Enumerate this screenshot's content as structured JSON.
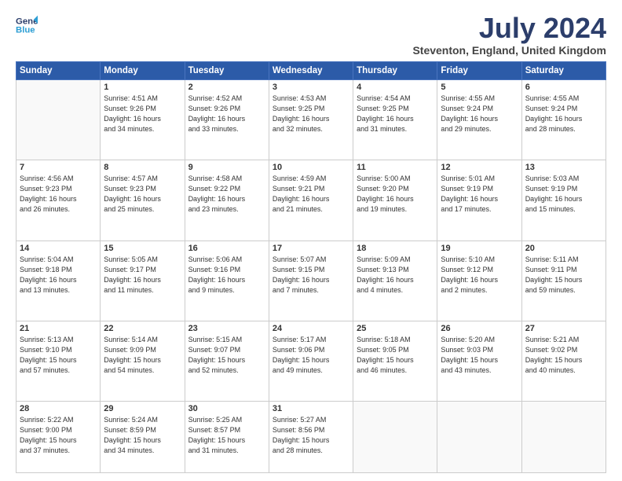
{
  "header": {
    "logo_line1": "General",
    "logo_line2": "Blue",
    "month_year": "July 2024",
    "location": "Steventon, England, United Kingdom"
  },
  "weekdays": [
    "Sunday",
    "Monday",
    "Tuesday",
    "Wednesday",
    "Thursday",
    "Friday",
    "Saturday"
  ],
  "weeks": [
    [
      {
        "day": "",
        "info": ""
      },
      {
        "day": "1",
        "info": "Sunrise: 4:51 AM\nSunset: 9:26 PM\nDaylight: 16 hours\nand 34 minutes."
      },
      {
        "day": "2",
        "info": "Sunrise: 4:52 AM\nSunset: 9:26 PM\nDaylight: 16 hours\nand 33 minutes."
      },
      {
        "day": "3",
        "info": "Sunrise: 4:53 AM\nSunset: 9:25 PM\nDaylight: 16 hours\nand 32 minutes."
      },
      {
        "day": "4",
        "info": "Sunrise: 4:54 AM\nSunset: 9:25 PM\nDaylight: 16 hours\nand 31 minutes."
      },
      {
        "day": "5",
        "info": "Sunrise: 4:55 AM\nSunset: 9:24 PM\nDaylight: 16 hours\nand 29 minutes."
      },
      {
        "day": "6",
        "info": "Sunrise: 4:55 AM\nSunset: 9:24 PM\nDaylight: 16 hours\nand 28 minutes."
      }
    ],
    [
      {
        "day": "7",
        "info": "Sunrise: 4:56 AM\nSunset: 9:23 PM\nDaylight: 16 hours\nand 26 minutes."
      },
      {
        "day": "8",
        "info": "Sunrise: 4:57 AM\nSunset: 9:23 PM\nDaylight: 16 hours\nand 25 minutes."
      },
      {
        "day": "9",
        "info": "Sunrise: 4:58 AM\nSunset: 9:22 PM\nDaylight: 16 hours\nand 23 minutes."
      },
      {
        "day": "10",
        "info": "Sunrise: 4:59 AM\nSunset: 9:21 PM\nDaylight: 16 hours\nand 21 minutes."
      },
      {
        "day": "11",
        "info": "Sunrise: 5:00 AM\nSunset: 9:20 PM\nDaylight: 16 hours\nand 19 minutes."
      },
      {
        "day": "12",
        "info": "Sunrise: 5:01 AM\nSunset: 9:19 PM\nDaylight: 16 hours\nand 17 minutes."
      },
      {
        "day": "13",
        "info": "Sunrise: 5:03 AM\nSunset: 9:19 PM\nDaylight: 16 hours\nand 15 minutes."
      }
    ],
    [
      {
        "day": "14",
        "info": "Sunrise: 5:04 AM\nSunset: 9:18 PM\nDaylight: 16 hours\nand 13 minutes."
      },
      {
        "day": "15",
        "info": "Sunrise: 5:05 AM\nSunset: 9:17 PM\nDaylight: 16 hours\nand 11 minutes."
      },
      {
        "day": "16",
        "info": "Sunrise: 5:06 AM\nSunset: 9:16 PM\nDaylight: 16 hours\nand 9 minutes."
      },
      {
        "day": "17",
        "info": "Sunrise: 5:07 AM\nSunset: 9:15 PM\nDaylight: 16 hours\nand 7 minutes."
      },
      {
        "day": "18",
        "info": "Sunrise: 5:09 AM\nSunset: 9:13 PM\nDaylight: 16 hours\nand 4 minutes."
      },
      {
        "day": "19",
        "info": "Sunrise: 5:10 AM\nSunset: 9:12 PM\nDaylight: 16 hours\nand 2 minutes."
      },
      {
        "day": "20",
        "info": "Sunrise: 5:11 AM\nSunset: 9:11 PM\nDaylight: 15 hours\nand 59 minutes."
      }
    ],
    [
      {
        "day": "21",
        "info": "Sunrise: 5:13 AM\nSunset: 9:10 PM\nDaylight: 15 hours\nand 57 minutes."
      },
      {
        "day": "22",
        "info": "Sunrise: 5:14 AM\nSunset: 9:09 PM\nDaylight: 15 hours\nand 54 minutes."
      },
      {
        "day": "23",
        "info": "Sunrise: 5:15 AM\nSunset: 9:07 PM\nDaylight: 15 hours\nand 52 minutes."
      },
      {
        "day": "24",
        "info": "Sunrise: 5:17 AM\nSunset: 9:06 PM\nDaylight: 15 hours\nand 49 minutes."
      },
      {
        "day": "25",
        "info": "Sunrise: 5:18 AM\nSunset: 9:05 PM\nDaylight: 15 hours\nand 46 minutes."
      },
      {
        "day": "26",
        "info": "Sunrise: 5:20 AM\nSunset: 9:03 PM\nDaylight: 15 hours\nand 43 minutes."
      },
      {
        "day": "27",
        "info": "Sunrise: 5:21 AM\nSunset: 9:02 PM\nDaylight: 15 hours\nand 40 minutes."
      }
    ],
    [
      {
        "day": "28",
        "info": "Sunrise: 5:22 AM\nSunset: 9:00 PM\nDaylight: 15 hours\nand 37 minutes."
      },
      {
        "day": "29",
        "info": "Sunrise: 5:24 AM\nSunset: 8:59 PM\nDaylight: 15 hours\nand 34 minutes."
      },
      {
        "day": "30",
        "info": "Sunrise: 5:25 AM\nSunset: 8:57 PM\nDaylight: 15 hours\nand 31 minutes."
      },
      {
        "day": "31",
        "info": "Sunrise: 5:27 AM\nSunset: 8:56 PM\nDaylight: 15 hours\nand 28 minutes."
      },
      {
        "day": "",
        "info": ""
      },
      {
        "day": "",
        "info": ""
      },
      {
        "day": "",
        "info": ""
      }
    ]
  ]
}
